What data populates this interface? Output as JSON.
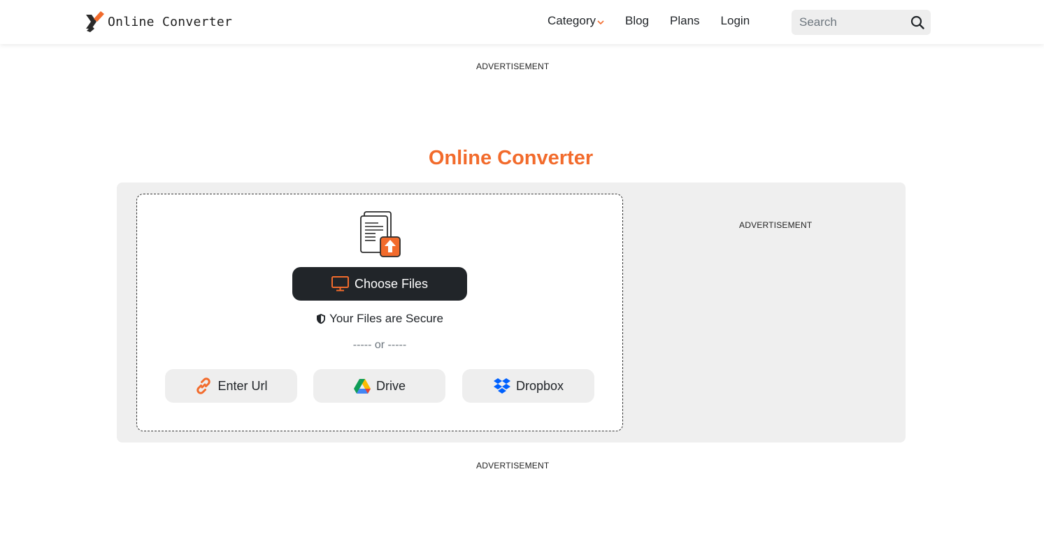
{
  "brand": {
    "name": "Online Converter"
  },
  "nav": {
    "items": [
      {
        "label": "Category"
      },
      {
        "label": "Blog"
      },
      {
        "label": "Plans"
      },
      {
        "label": "Login"
      }
    ]
  },
  "search": {
    "placeholder": "Search"
  },
  "ads": {
    "top": "ADVERTISEMENT",
    "side": "ADVERTISEMENT",
    "bottom": "ADVERTISEMENT"
  },
  "main": {
    "title": "Online Converter",
    "choose_files": "Choose Files",
    "secure_text": "Your Files are Secure",
    "or_text": "----- or -----",
    "sources": [
      {
        "label": "Enter Url",
        "icon": "link-icon"
      },
      {
        "label": "Drive",
        "icon": "google-drive-icon"
      },
      {
        "label": "Dropbox",
        "icon": "dropbox-icon"
      }
    ]
  },
  "colors": {
    "accent": "#f26b2c",
    "dark": "#212529",
    "panel": "#efefef",
    "chip": "#eeeeee"
  }
}
